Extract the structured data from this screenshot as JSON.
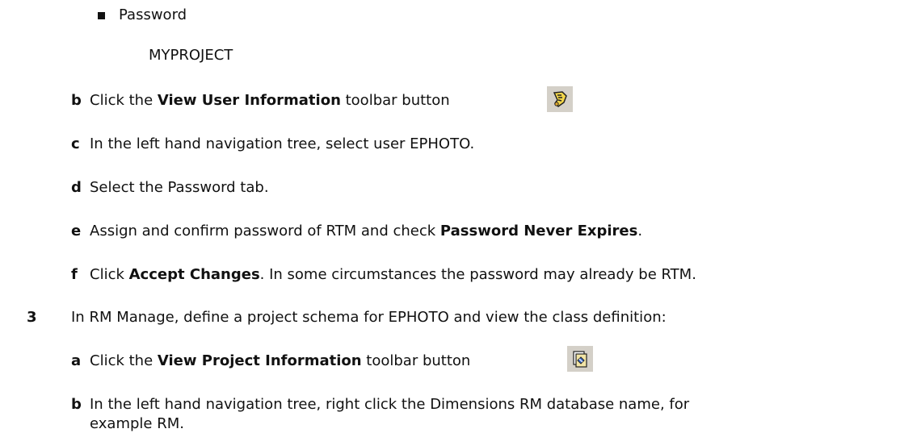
{
  "bullet_item": {
    "label": "Password",
    "value": "MYPROJECT"
  },
  "steps_b": {
    "letter": "b",
    "text_before": "Click the ",
    "bold": "View User Information",
    "text_after": " toolbar button",
    "icon": "view-user-information-icon"
  },
  "steps_c": {
    "letter": "c",
    "text": "In the left hand navigation tree, select user EPHOTO."
  },
  "steps_d": {
    "letter": "d",
    "text": "Select the Password tab."
  },
  "steps_e": {
    "letter": "e",
    "text_before": "Assign and confirm password of RTM and check ",
    "bold": "Password Never Expires",
    "text_after": "."
  },
  "steps_f": {
    "letter": "f",
    "text_before": "Click ",
    "bold": "Accept Changes",
    "text_after": ". In some circumstances the password may already be RTM."
  },
  "step3": {
    "number": "3",
    "text": "In RM Manage, define a project schema for EPHOTO and view the class definition:"
  },
  "step3_a": {
    "letter": "a",
    "text_before": "Click the ",
    "bold": "View Project Information",
    "text_after": " toolbar button",
    "icon": "view-project-information-icon"
  },
  "step3_b": {
    "letter": "b",
    "line1": "In the left hand navigation tree, right click the Dimensions RM database name, for",
    "line2": "example RM."
  }
}
